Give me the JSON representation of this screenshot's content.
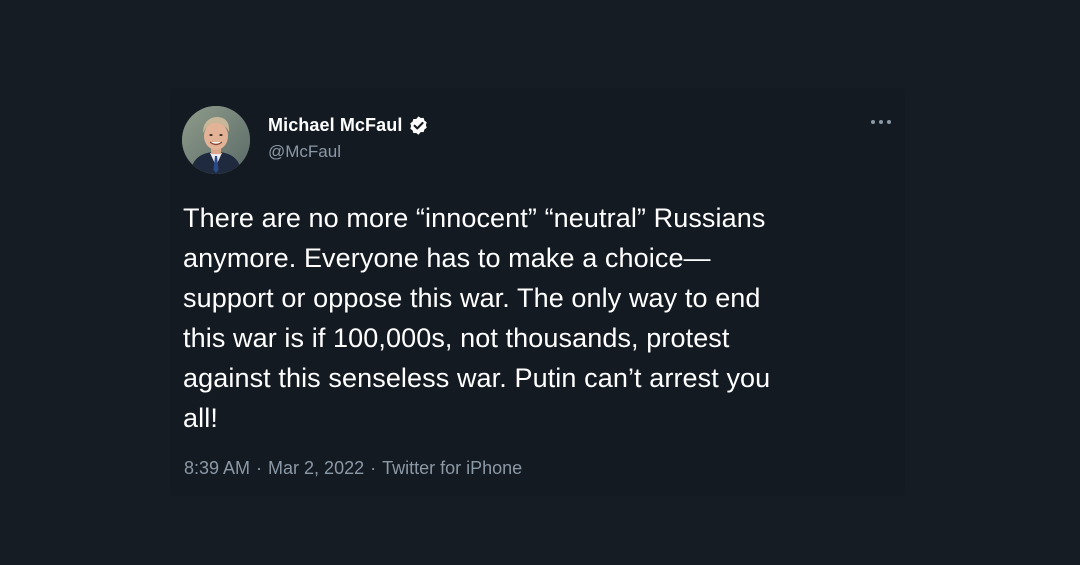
{
  "tweet": {
    "author": {
      "display_name": "Michael McFaul",
      "handle": "@McFaul",
      "verified_icon": "verified-badge-icon",
      "avatar": "profile-photo"
    },
    "more_icon": "more-horizontal-icon",
    "text": "There are no more “innocent” “neutral” Russians\nanymore. Everyone has to make a choice—\nsupport or oppose this war. The only way to end\nthis war is if 100,000s, not thousands, protest\nagainst this senseless war. Putin can’t arrest you\nall!",
    "meta": {
      "time": "8:39 AM",
      "separator": "·",
      "date": "Mar 2, 2022",
      "source": "Twitter for iPhone"
    }
  },
  "colors": {
    "background": "#151c24",
    "card": "#141a22",
    "text_primary": "#ffffff",
    "text_secondary": "#8b98a5"
  }
}
